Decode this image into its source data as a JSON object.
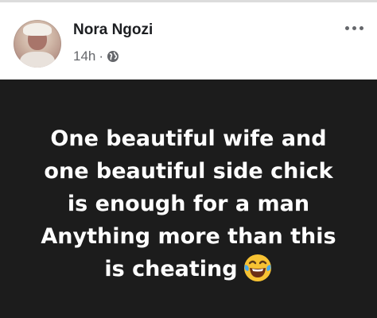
{
  "post": {
    "author": "Nora Ngozi",
    "time": "14h",
    "separator": "·",
    "privacy_icon": "globe-icon",
    "more_icon": "more-options-icon",
    "text_lines": [
      "One beautiful wife and",
      "one beautiful side chick",
      "is enough for a man",
      "Anything more than this",
      "is cheating"
    ],
    "emoji": "tears-of-joy-emoji",
    "background_color": "#1c1c1c",
    "text_color": "#ffffff"
  }
}
